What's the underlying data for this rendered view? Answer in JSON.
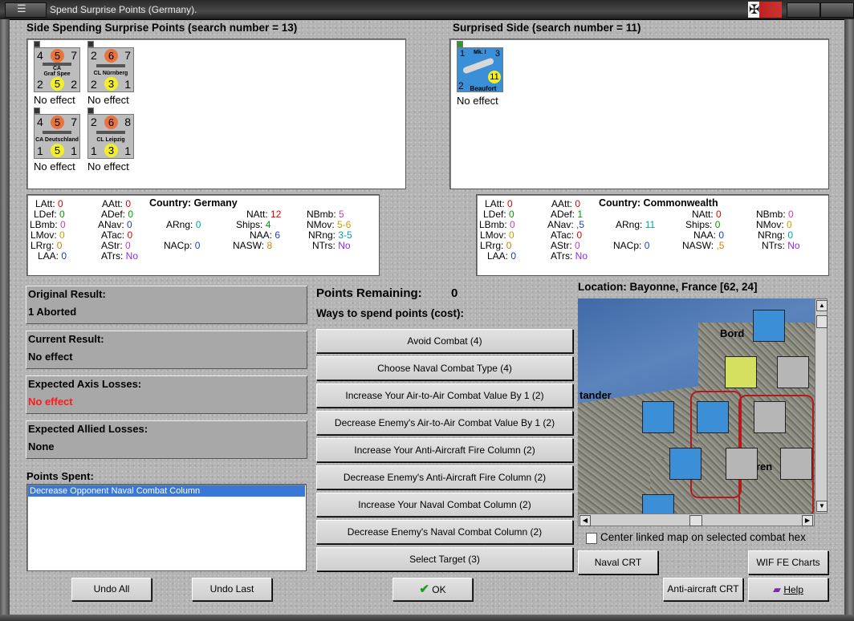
{
  "window": {
    "title": "Spend Surprise Points (Germany)."
  },
  "left_side": {
    "heading": "Side Spending Surprise Points (search number = 13)",
    "counters": [
      {
        "top_left": "4",
        "top_mid": "5",
        "top_right": "7",
        "name": "CA\nGraf Spee",
        "bot_left": "2",
        "bot_mid": "5",
        "bot_right": "2",
        "status": "No effect"
      },
      {
        "top_left": "2",
        "top_mid": "6",
        "top_right": "7",
        "name": "CL Nürnberg",
        "bot_left": "2",
        "bot_mid": "3",
        "bot_right": "1",
        "status": "No effect"
      },
      {
        "top_left": "4",
        "top_mid": "5",
        "top_right": "7",
        "name": "CA Deutschland",
        "bot_left": "1",
        "bot_mid": "5",
        "bot_right": "1",
        "status": "No effect"
      },
      {
        "top_left": "2",
        "top_mid": "6",
        "top_right": "8",
        "name": "CL Leipzig",
        "bot_left": "1",
        "bot_mid": "3",
        "bot_right": "1",
        "status": "No effect"
      }
    ]
  },
  "right_side": {
    "heading": "Surprised Side (search number = 11)",
    "counters": [
      {
        "top_left": "1",
        "top_mid": "Mk. I",
        "top_right": "3",
        "name": "Beaufort",
        "bot_left": "2",
        "bot_mid": "11",
        "status": "No effect"
      }
    ]
  },
  "left_stats": {
    "country_label": "Country: Germany",
    "items": [
      {
        "label": "LAtt:",
        "value": "0"
      },
      {
        "label": "LDef:",
        "value": "0"
      },
      {
        "label": "LBmb:",
        "value": "0"
      },
      {
        "label": "LMov:",
        "value": "0"
      },
      {
        "label": "LRrg:",
        "value": "0"
      },
      {
        "label": "LAA:",
        "value": "0"
      },
      {
        "label": "AAtt:",
        "value": "0"
      },
      {
        "label": "ADef:",
        "value": "0"
      },
      {
        "label": "ANav:",
        "value": "0"
      },
      {
        "label": "ATac:",
        "value": "0"
      },
      {
        "label": "AStr:",
        "value": "0"
      },
      {
        "label": "ATrs:",
        "value": "No"
      },
      {
        "label": "ARng:",
        "value": "0"
      },
      {
        "label": "NACp:",
        "value": "0"
      },
      {
        "label": "NAtt:",
        "value": "12"
      },
      {
        "label": "Ships:",
        "value": "4"
      },
      {
        "label": "NAA:",
        "value": "6"
      },
      {
        "label": "NASW:",
        "value": "8"
      },
      {
        "label": "NBmb:",
        "value": "5"
      },
      {
        "label": "NMov:",
        "value": "5-6"
      },
      {
        "label": "NRng:",
        "value": "3-5"
      },
      {
        "label": "NTrs:",
        "value": "No"
      }
    ]
  },
  "right_stats": {
    "country_label": "Country: Commonwealth",
    "items": [
      {
        "label": "LAtt:",
        "value": "0"
      },
      {
        "label": "LDef:",
        "value": "0"
      },
      {
        "label": "LBmb:",
        "value": "0"
      },
      {
        "label": "LMov:",
        "value": "0"
      },
      {
        "label": "LRrg:",
        "value": "0"
      },
      {
        "label": "LAA:",
        "value": "0"
      },
      {
        "label": "AAtt:",
        "value": "0"
      },
      {
        "label": "ADef:",
        "value": "1"
      },
      {
        "label": "ANav:",
        "value": ",5"
      },
      {
        "label": "ATac:",
        "value": "0"
      },
      {
        "label": "AStr:",
        "value": "0"
      },
      {
        "label": "ATrs:",
        "value": "No"
      },
      {
        "label": "ARng:",
        "value": "11"
      },
      {
        "label": "NACp:",
        "value": "0"
      },
      {
        "label": "NAtt:",
        "value": "0"
      },
      {
        "label": "Ships:",
        "value": "0"
      },
      {
        "label": "NAA:",
        "value": "0"
      },
      {
        "label": "NASW:",
        "value": ",5"
      },
      {
        "label": "NBmb:",
        "value": "0"
      },
      {
        "label": "NMov:",
        "value": "0"
      },
      {
        "label": "NRng:",
        "value": "0"
      },
      {
        "label": "NTrs:",
        "value": "No"
      }
    ]
  },
  "results": {
    "original_label": "Original Result:",
    "original_value": "1 Aborted",
    "current_label": "Current Result:",
    "current_value": "No effect",
    "axis_label": "Expected Axis Losses:",
    "axis_value": "No effect",
    "allied_label": "Expected Allied Losses:",
    "allied_value": "None",
    "spent_label": "Points Spent:",
    "spent_items": [
      "Decrease Opponent Naval Combat Column"
    ]
  },
  "points": {
    "remaining_label": "Points Remaining:",
    "remaining_value": "0",
    "ways_label": "Ways to spend points (cost):",
    "options": [
      "Avoid Combat (4)",
      "Choose Naval Combat Type (4)",
      "Increase Your Air-to-Air Combat Value By 1 (2)",
      "Decrease Enemy's Air-to-Air Combat Value By 1 (2)",
      "Increase Your Anti-Aircraft Fire Column (2)",
      "Decrease Enemy's Anti-Aircraft Fire Column (2)",
      "Increase Your Naval Combat Column (2)",
      "Decrease Enemy's Naval Combat Column (2)",
      "Select Target (3)"
    ]
  },
  "map": {
    "location": "Location: Bayonne, France [62, 24]",
    "place_labels": [
      "Bord",
      "tander",
      "ren"
    ],
    "center_checkbox_label": "Center linked map on selected combat hex",
    "center_checked": false
  },
  "buttons": {
    "undo_all": "Undo All",
    "undo_last": "Undo Last",
    "ok": "OK",
    "naval_crt": "Naval CRT",
    "wif_charts": "WIF FE Charts",
    "aa_crt": "Anti-aircraft CRT",
    "help": "Help"
  },
  "colors": {
    "red_value": "#e00000",
    "green_value": "#009a00",
    "selected_item": "#3a78d8"
  }
}
